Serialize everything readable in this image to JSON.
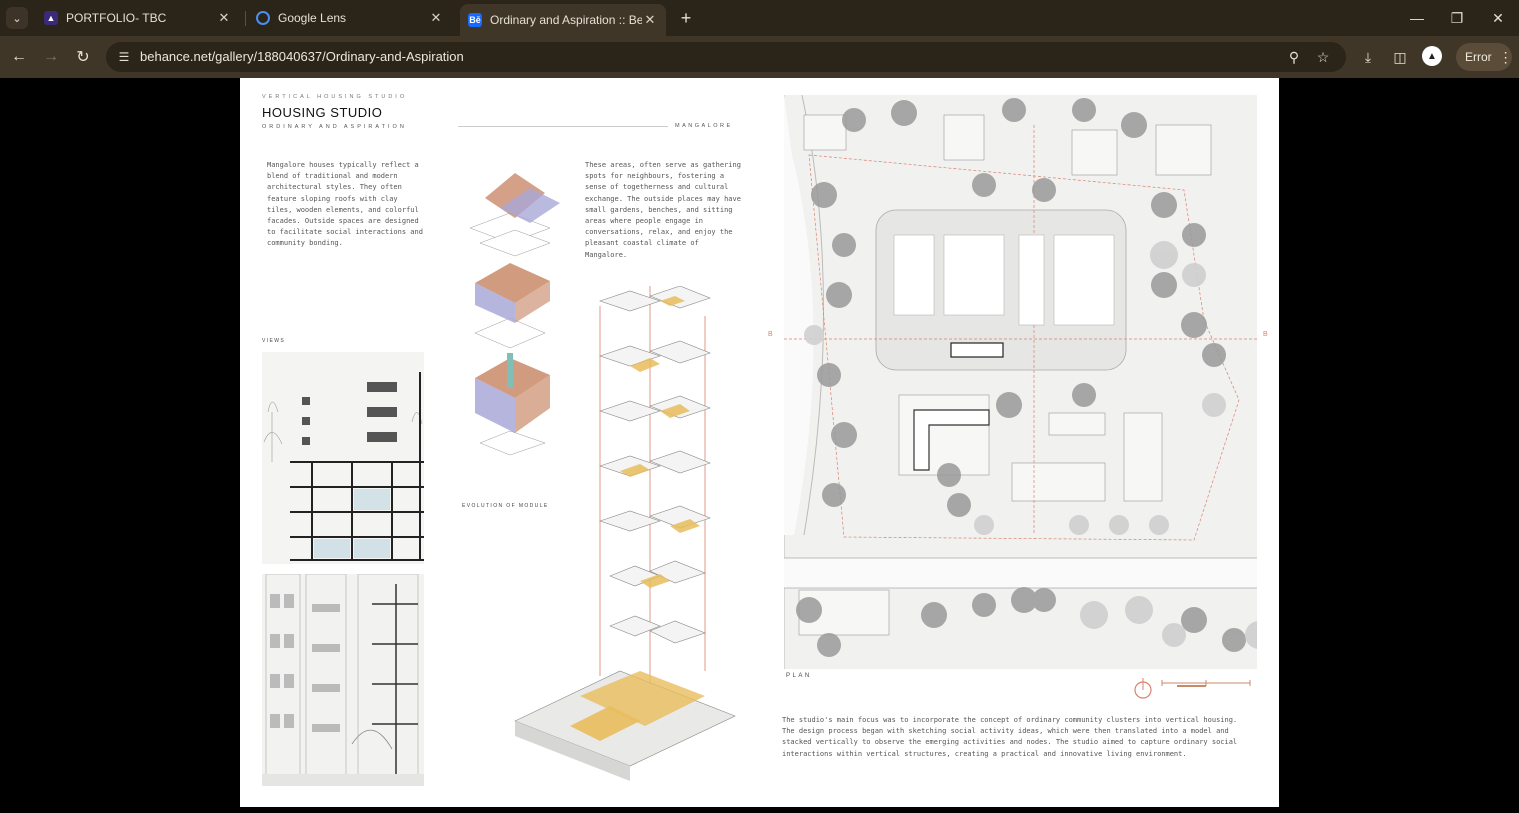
{
  "browser": {
    "tabs": [
      {
        "title": "PORTFOLIO- TBC",
        "favicon": "portfolio-icon",
        "active": false
      },
      {
        "title": "Google Lens",
        "favicon": "google-lens-icon",
        "active": false
      },
      {
        "title": "Ordinary and Aspiration :: Behance",
        "favicon": "behance-icon",
        "active": true
      }
    ],
    "url": "behance.net/gallery/188040637/Ordinary-and-Aspiration",
    "error_label": "Error",
    "favicon_text": "Bē"
  },
  "sheet": {
    "kicker": "VERTICAL HOUSING STUDIO",
    "title": "HOUSING STUDIO",
    "subtitle": "ORDINARY AND ASPIRATION",
    "intro": "Mangalore houses typically reflect a blend of traditional and modern architectural styles. They often feature sloping roofs with clay tiles, wooden elements, and colorful facades. Outside spaces are designed to facilitate social interactions and community bonding.",
    "place": "MANGALORE",
    "gathering": "These areas, often serve as gathering spots for neighbours, fostering a sense of togetherness and cultural exchange. The outside places may have small gardens, benches, and sitting areas where people engage in conversations, relax, and enjoy the pleasant coastal climate of Mangalore.",
    "views_label": "VIEWS",
    "evolution_label": "EVOLUTION OF MODULE",
    "plan_label": "PLAN",
    "section_marker": "B",
    "focus": "The studio's main focus was to incorporate the concept of ordinary community clusters into vertical housing. The design process began with sketching social activity ideas, which were then translated into a model and stacked vertically to observe the emerging activities and nodes. The studio aimed to capture ordinary social interactions within vertical structures, creating a practical and innovative living environment."
  },
  "colors": {
    "tabbar": "#2b2419",
    "toolbar": "#3f3628",
    "accent_terracotta": "#c98a6a",
    "accent_lavender": "#a9a8d8",
    "accent_yellow": "#e8bd5c",
    "red_line": "#d9826d"
  }
}
